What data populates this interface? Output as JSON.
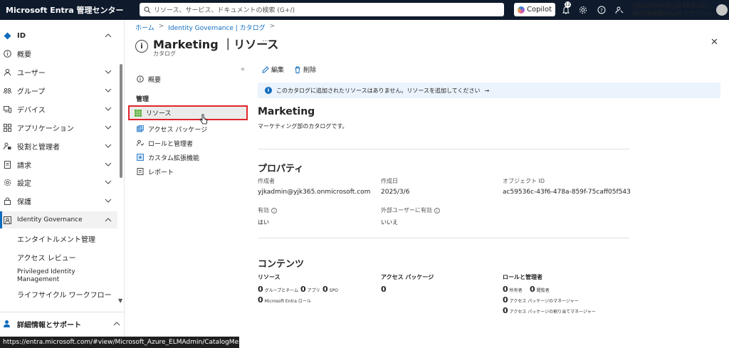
{
  "app": {
    "title": "Microsoft Entra 管理センター",
    "search_placeholder": "リソース、サービス、ドキュメントの検索 (G+/)",
    "copilot_label": "Copilot",
    "notification_count": "12",
    "user_name": "yjkadmin@yjk365.on...",
    "user_org": "横浜情報機器株式会社 クラウドー..."
  },
  "sidebar": {
    "items": [
      {
        "label": "ID",
        "icon": "diamond-icon"
      },
      {
        "label": "概要",
        "icon": "info-icon"
      },
      {
        "label": "ユーザー",
        "icon": "person-icon"
      },
      {
        "label": "グループ",
        "icon": "group-icon"
      },
      {
        "label": "デバイス",
        "icon": "device-icon"
      },
      {
        "label": "アプリケーション",
        "icon": "apps-icon"
      },
      {
        "label": "役割と管理者",
        "icon": "roles-icon"
      },
      {
        "label": "請求",
        "icon": "billing-icon"
      },
      {
        "label": "設定",
        "icon": "gear-icon"
      },
      {
        "label": "保護",
        "icon": "lock-icon"
      },
      {
        "label": "Identity Governance",
        "icon": "governance-icon"
      }
    ],
    "sub_items": [
      "エンタイトルメント管理",
      "アクセス レビュー",
      "Privileged Identity",
      "Management",
      "ライフサイクル ワークフロー"
    ],
    "support_label": "詳細情報とサポート"
  },
  "status_url": "https://entra.microsoft.com/#view/Microsoft_Azure_ELMAdmin/CatalogMen...",
  "breadcrumb": [
    "ホーム",
    "Identity Governance | カタログ"
  ],
  "page": {
    "title": "Marketing ｜リソース",
    "subtitle": "カタログ",
    "more": "···",
    "close": "✕"
  },
  "menu": {
    "collapse": "«",
    "overview": "概要",
    "section": "管理",
    "items": [
      "リソース",
      "アクセス パッケージ",
      "ロールと管理者",
      "カスタム拡張機能",
      "レポート"
    ]
  },
  "toolbar": {
    "edit": "編集",
    "delete": "削除"
  },
  "info": {
    "text": "このカタログに追加されたリソースはありません。リソースを追加してください",
    "arrow": "→"
  },
  "catalog": {
    "name": "Marketing",
    "description": "マーケティング部のカタログです。"
  },
  "properties": {
    "heading": "プロパティ",
    "created_by_label": "作成者",
    "created_by": "yjkadmin@yjk365.onmicrosoft.com",
    "created_date_label": "作成日",
    "created_date": "2025/3/6",
    "object_id_label": "オブジェクト ID",
    "object_id": "ac59536c-43f6-478a-859f-75caff05f543",
    "enabled_label": "有効",
    "enabled": "はい",
    "external_label": "外部ユーザーに有効",
    "external": "いいえ"
  },
  "contents": {
    "heading": "コンテンツ",
    "resources_label": "リソース",
    "groups_count": "0",
    "groups_label": "グループとチーム",
    "apps_count": "0",
    "apps_label": "アプリ",
    "spo_count": "0",
    "spo_label": "SPO",
    "roles_count": "0",
    "roles_label": "Microsoft Entra ロール",
    "packages_label": "アクセス パッケージ",
    "packages_count": "0",
    "roles_admins_label": "ロールと管理者",
    "owners_count": "0",
    "owners_label": "所有者",
    "readers_count": "0",
    "readers_label": "閲覧者",
    "pkg_managers_count": "0",
    "pkg_managers_label": "アクセス パッケージのマネージャー",
    "pkg_assign_count": "0",
    "pkg_assign_label": "アクセス パッケージの割り当てマネージャー"
  },
  "colors": {
    "topbar": "#0f1b2d",
    "accent": "#0f6cbd",
    "highlight": "#e0252b"
  }
}
